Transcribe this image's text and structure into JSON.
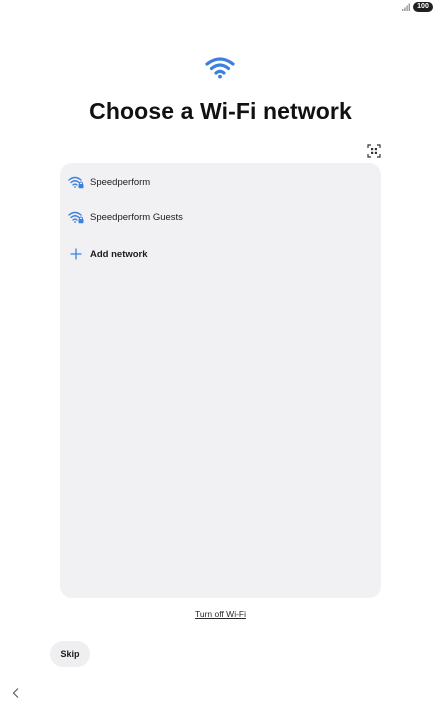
{
  "status_bar": {
    "signal_icon": "signal-icon",
    "battery_level": "100"
  },
  "header": {
    "icon": "wifi-icon",
    "title": "Choose a Wi-Fi network",
    "qr_icon": "qr-scan-icon"
  },
  "networks": [
    {
      "name": "Speedperform",
      "icon": "wifi-lock-icon"
    },
    {
      "name": "Speedperform Guests",
      "icon": "wifi-lock-icon"
    }
  ],
  "add_network": {
    "label": "Add network",
    "icon": "plus-icon"
  },
  "turn_off_wifi": "Turn off Wi-Fi",
  "skip": "Skip",
  "nav": {
    "back_icon": "back-chevron-icon"
  },
  "colors": {
    "accent": "#3d7fe0",
    "card_background": "#f1f1f3",
    "title": "#111111"
  }
}
